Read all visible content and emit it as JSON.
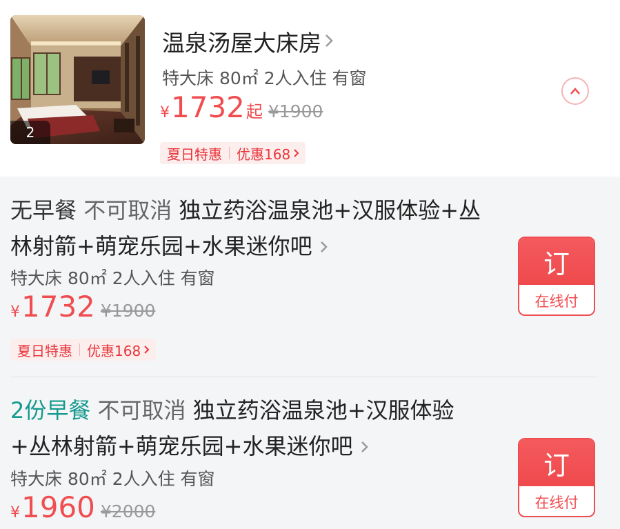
{
  "room": {
    "title": "温泉汤屋大床房",
    "photo_count": "2",
    "spec": "特大床 80㎡ 2人入住 有窗",
    "currency": "¥",
    "price": "1732",
    "price_suffix": "起",
    "original_price": "¥1900",
    "promo": {
      "tag": "夏日特惠",
      "discount": "优惠168"
    }
  },
  "plans": [
    {
      "meal": "无早餐",
      "cancel": "不可取消",
      "package": "独立药浴温泉池+汉服体验+丛林射箭+萌宠乐园+水果迷你吧",
      "spec": "特大床 80㎡ 2人入住 有窗",
      "currency": "¥",
      "price": "1732",
      "original_price": "¥1900",
      "promo": {
        "tag": "夏日特惠",
        "discount": "优惠168"
      },
      "book_label": "订",
      "pay_label": "在线付"
    },
    {
      "meal": "2份早餐",
      "cancel": "不可取消",
      "package": "独立药浴温泉池+汉服体验+丛林射箭+萌宠乐园+水果迷你吧",
      "spec": "特大床 80㎡ 2人入住 有窗",
      "currency": "¥",
      "price": "1960",
      "original_price": "¥2000",
      "book_label": "订",
      "pay_label": "在线付"
    }
  ],
  "colors": {
    "accent": "#f04d50",
    "breakfast_green": "#15998e",
    "plan_background": "#f4f5f7",
    "promo_background": "#fdeeee"
  },
  "icons": [
    "chevron-right-icon",
    "chevron-up-icon"
  ]
}
